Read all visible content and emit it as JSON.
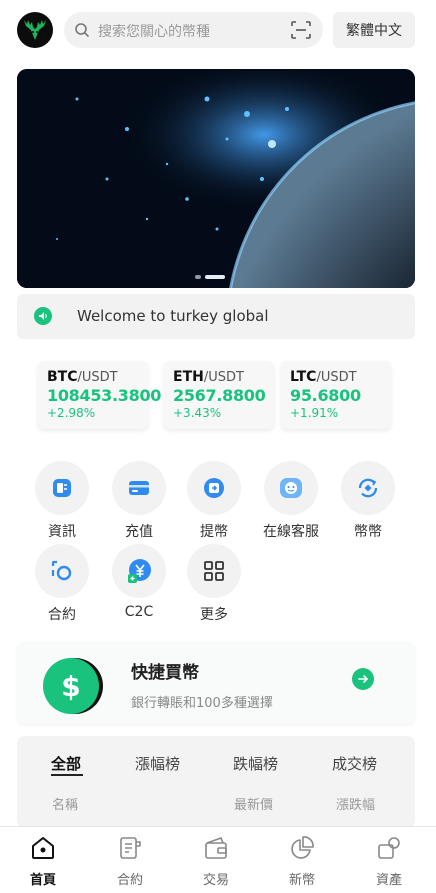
{
  "header": {
    "search_placeholder": "搜索您關心的幣種",
    "language_label": "繁體中文",
    "logo_icon": "deer-logo-icon",
    "search_icon": "search-icon",
    "scan_icon": "scan-icon"
  },
  "notice": {
    "text": "Welcome to turkey global",
    "icon": "speaker-icon"
  },
  "tickers": [
    {
      "base": "BTC",
      "quote": "/USDT",
      "price": "108453.3800",
      "change": "+2.98%"
    },
    {
      "base": "ETH",
      "quote": "/USDT",
      "price": "2567.8800",
      "change": "+3.43%"
    },
    {
      "base": "LTC",
      "quote": "/USDT",
      "price": "95.6800",
      "change": "+1.91%"
    }
  ],
  "quick_links": [
    {
      "label": "資訊",
      "icon": "news-icon"
    },
    {
      "label": "充值",
      "icon": "card-icon"
    },
    {
      "label": "提幣",
      "icon": "withdraw-icon"
    },
    {
      "label": "在線客服",
      "icon": "support-icon"
    },
    {
      "label": "幣幣",
      "icon": "exchange-icon"
    },
    {
      "label": "合約",
      "icon": "contract-icon"
    },
    {
      "label": "C2C",
      "icon": "yen-icon"
    },
    {
      "label": "更多",
      "icon": "grid-icon"
    }
  ],
  "promo": {
    "title": "快捷買幣",
    "subtitle": "銀行轉賬和100多種選擇",
    "icon": "dollar-coin-icon"
  },
  "market": {
    "tabs": [
      "全部",
      "漲幅榜",
      "跌幅榜",
      "成交榜"
    ],
    "active_tab": "全部",
    "columns": [
      "名稱",
      "最新價",
      "漲跌幅"
    ]
  },
  "bottom_nav": [
    {
      "label": "首頁",
      "icon": "home-icon",
      "active": true
    },
    {
      "label": "合約",
      "icon": "contract-doc-icon",
      "active": false
    },
    {
      "label": "交易",
      "icon": "wallet-icon",
      "active": false
    },
    {
      "label": "新幣",
      "icon": "pie-icon",
      "active": false
    },
    {
      "label": "資產",
      "icon": "assets-icon",
      "active": false
    }
  ],
  "colors": {
    "accent_green": "#19c37d",
    "icon_blue": "#2f8bf0"
  }
}
